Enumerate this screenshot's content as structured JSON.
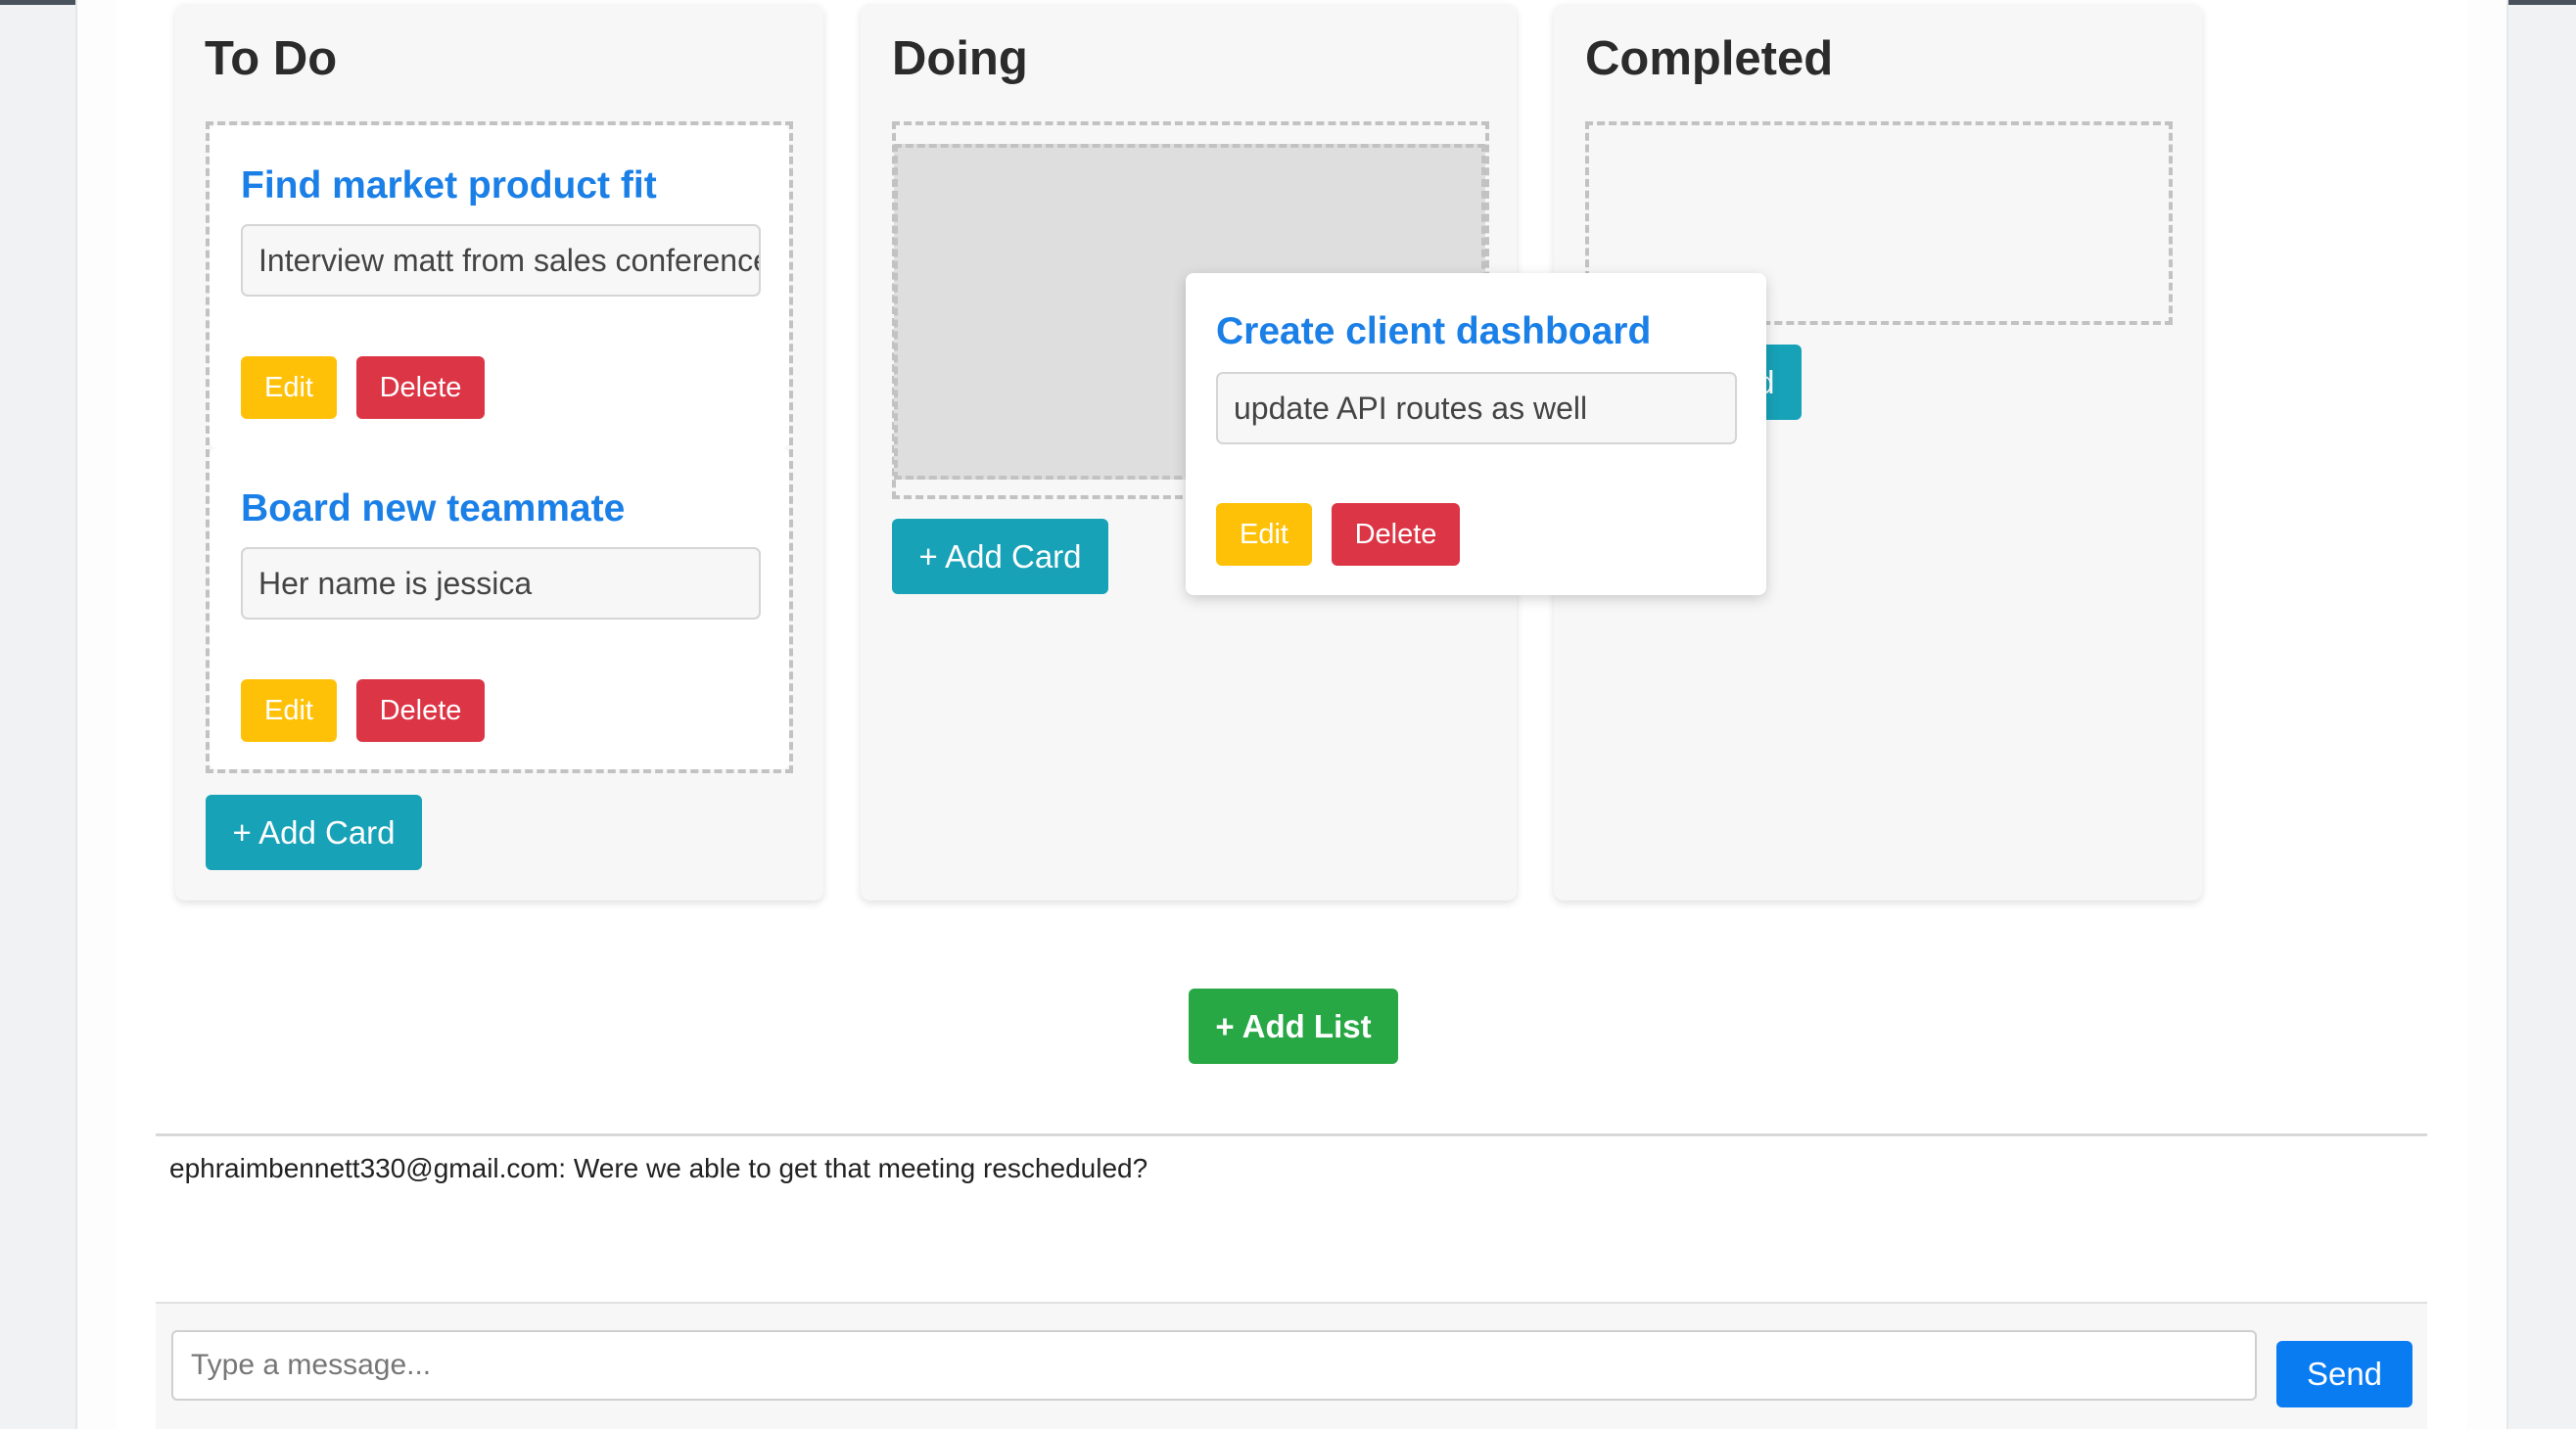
{
  "lists": [
    {
      "title": "To Do",
      "cards": [
        {
          "title": "Find market product fit",
          "description": "Interview matt from sales conference",
          "edit_label": "Edit",
          "delete_label": "Delete"
        },
        {
          "title": "Board new teammate",
          "description": "Her name is jessica",
          "edit_label": "Edit",
          "delete_label": "Delete"
        }
      ],
      "add_card_label": "+ Add Card"
    },
    {
      "title": "Doing",
      "cards": [],
      "add_card_label": "+ Add Card"
    },
    {
      "title": "Completed",
      "cards": [],
      "add_card_label": "+ Add Card"
    }
  ],
  "dragging_card": {
    "title": "Create client dashboard",
    "description": "update API routes as well",
    "edit_label": "Edit",
    "delete_label": "Delete"
  },
  "add_list_label": "+ Add List",
  "chat": {
    "messages": [
      {
        "text": "ephraimbennett330@gmail.com: Were we able to get that meeting rescheduled?"
      }
    ],
    "input_placeholder": "Type a message...",
    "send_label": "Send"
  },
  "colors": {
    "card_title": "#1a7fe6",
    "edit": "#ffc107",
    "delete": "#dc3545",
    "add_card": "#17a2b8",
    "add_list": "#28a745",
    "send": "#0a7cf2"
  }
}
